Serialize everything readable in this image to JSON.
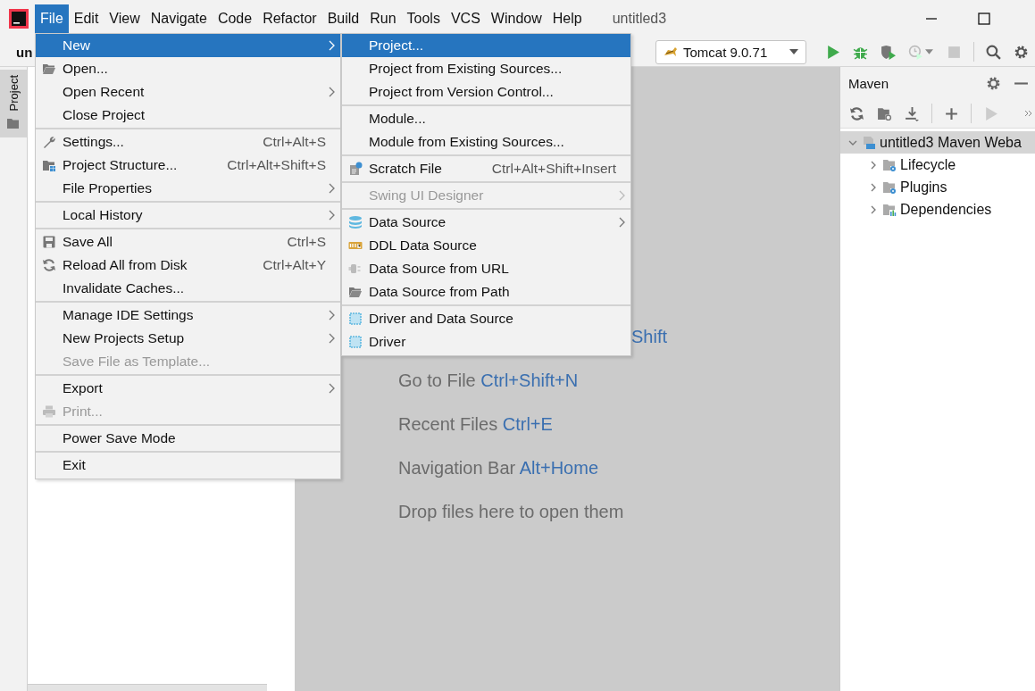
{
  "window": {
    "title": "untitled3",
    "menu_bar": [
      {
        "label": "File",
        "selected": true
      },
      {
        "label": "Edit",
        "selected": false
      },
      {
        "label": "View",
        "selected": false
      },
      {
        "label": "Navigate",
        "selected": false
      },
      {
        "label": "Code",
        "selected": false
      },
      {
        "label": "Refactor",
        "selected": false
      },
      {
        "label": "Build",
        "selected": false
      },
      {
        "label": "Run",
        "selected": false
      },
      {
        "label": "Tools",
        "selected": false
      },
      {
        "label": "VCS",
        "selected": false
      },
      {
        "label": "Window",
        "selected": false
      },
      {
        "label": "Help",
        "selected": false
      }
    ]
  },
  "toolbar": {
    "project_name": "un",
    "run_config": "Tomcat 9.0.71"
  },
  "tool_stripe": {
    "tabs": [
      {
        "label": "Project",
        "selected": true
      }
    ]
  },
  "editor": {
    "hints": [
      {
        "shortcut": "Shift"
      },
      {
        "label": "Go to File",
        "shortcut": "Ctrl+Shift+N"
      },
      {
        "label": "Recent Files",
        "shortcut": "Ctrl+E"
      },
      {
        "label": "Navigation Bar",
        "shortcut": "Alt+Home"
      },
      {
        "label": "Drop files here to open them"
      }
    ]
  },
  "maven": {
    "title": "Maven",
    "tree": [
      {
        "label": "untitled3 Maven Weba",
        "expanded": true,
        "selected": true,
        "children": [
          {
            "label": "Lifecycle",
            "expanded": false,
            "selected": false
          },
          {
            "label": "Plugins",
            "expanded": false,
            "selected": false
          },
          {
            "label": "Dependencies",
            "expanded": false,
            "selected": false
          }
        ]
      }
    ]
  },
  "file_menu": {
    "groups": [
      [
        {
          "label": "New",
          "submenu": true,
          "selected": true,
          "disabled": false
        },
        {
          "label": "Open...",
          "submenu": false,
          "selected": false,
          "disabled": false
        },
        {
          "label": "Open Recent",
          "submenu": true,
          "selected": false,
          "disabled": false
        },
        {
          "label": "Close Project",
          "submenu": false,
          "selected": false,
          "disabled": false
        }
      ],
      [
        {
          "label": "Settings...",
          "shortcut": "Ctrl+Alt+S",
          "submenu": false,
          "selected": false,
          "disabled": false
        },
        {
          "label": "Project Structure...",
          "shortcut": "Ctrl+Alt+Shift+S",
          "submenu": false,
          "selected": false,
          "disabled": false
        },
        {
          "label": "File Properties",
          "submenu": true,
          "selected": false,
          "disabled": false
        }
      ],
      [
        {
          "label": "Local History",
          "submenu": true,
          "selected": false,
          "disabled": false
        }
      ],
      [
        {
          "label": "Save All",
          "shortcut": "Ctrl+S",
          "submenu": false,
          "selected": false,
          "disabled": false
        },
        {
          "label": "Reload All from Disk",
          "shortcut": "Ctrl+Alt+Y",
          "submenu": false,
          "selected": false,
          "disabled": false
        },
        {
          "label": "Invalidate Caches...",
          "submenu": false,
          "selected": false,
          "disabled": false
        }
      ],
      [
        {
          "label": "Manage IDE Settings",
          "submenu": true,
          "selected": false,
          "disabled": false
        },
        {
          "label": "New Projects Setup",
          "submenu": true,
          "selected": false,
          "disabled": false
        },
        {
          "label": "Save File as Template...",
          "submenu": false,
          "selected": false,
          "disabled": true
        }
      ],
      [
        {
          "label": "Export",
          "submenu": true,
          "selected": false,
          "disabled": false
        },
        {
          "label": "Print...",
          "submenu": false,
          "selected": false,
          "disabled": true
        }
      ],
      [
        {
          "label": "Power Save Mode",
          "submenu": false,
          "selected": false,
          "disabled": false
        }
      ],
      [
        {
          "label": "Exit",
          "submenu": false,
          "selected": false,
          "disabled": false
        }
      ]
    ]
  },
  "new_submenu": {
    "groups": [
      [
        {
          "label": "Project...",
          "submenu": false,
          "selected": true,
          "disabled": false
        },
        {
          "label": "Project from Existing Sources...",
          "submenu": false,
          "selected": false,
          "disabled": false
        },
        {
          "label": "Project from Version Control...",
          "submenu": false,
          "selected": false,
          "disabled": false
        }
      ],
      [
        {
          "label": "Module...",
          "submenu": false,
          "selected": false,
          "disabled": false
        },
        {
          "label": "Module from Existing Sources...",
          "submenu": false,
          "selected": false,
          "disabled": false
        }
      ],
      [
        {
          "label": "Scratch File",
          "shortcut": "Ctrl+Alt+Shift+Insert",
          "submenu": false,
          "selected": false,
          "disabled": false
        }
      ],
      [
        {
          "label": "Swing UI Designer",
          "submenu": true,
          "selected": false,
          "disabled": true
        }
      ],
      [
        {
          "label": "Data Source",
          "submenu": true,
          "selected": false,
          "disabled": false
        },
        {
          "label": "DDL Data Source",
          "submenu": false,
          "selected": false,
          "disabled": false
        },
        {
          "label": "Data Source from URL",
          "submenu": false,
          "selected": false,
          "disabled": false
        },
        {
          "label": "Data Source from Path",
          "submenu": false,
          "selected": false,
          "disabled": false
        }
      ],
      [
        {
          "label": "Driver and Data Source",
          "submenu": false,
          "selected": false,
          "disabled": false
        },
        {
          "label": "Driver",
          "submenu": false,
          "selected": false,
          "disabled": false
        }
      ]
    ]
  }
}
